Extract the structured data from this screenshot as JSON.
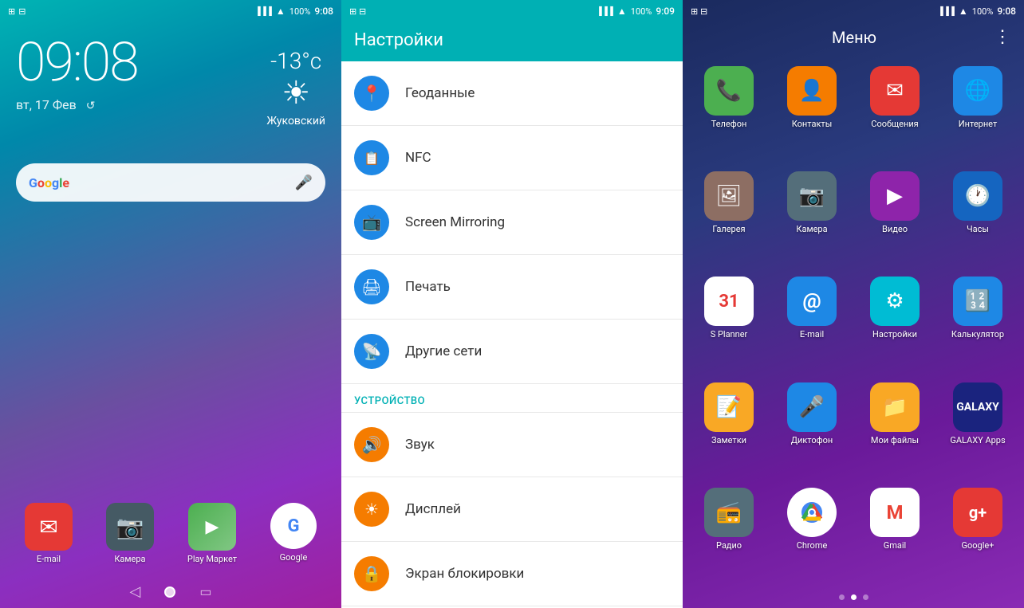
{
  "left": {
    "statusBar": {
      "screenshots": "⊞ ⊟",
      "signal": "▐▐▐▐",
      "wifi": "🛜",
      "battery": "100%",
      "time": "9:08"
    },
    "time": "09:08",
    "date": "вт, 17 Фев",
    "weather": {
      "temp": "-13°c",
      "city": "Жуковский",
      "icon": "☀"
    },
    "search": {
      "placeholder": "Google",
      "logo": "Google"
    },
    "dockApps": [
      {
        "id": "email",
        "label": "E-mail",
        "icon": "✉",
        "color": "#e53935"
      },
      {
        "id": "camera",
        "label": "Камера",
        "icon": "📷",
        "color": "#546e7a"
      },
      {
        "id": "play",
        "label": "Play\nМаркет",
        "icon": "▶",
        "color": "#4caf50"
      },
      {
        "id": "google",
        "label": "Google",
        "icon": "G",
        "color": "#fff"
      }
    ],
    "bottomNav": [
      "back",
      "home",
      "menu"
    ]
  },
  "middle": {
    "statusBar": {
      "signal": "▐▐▐▐",
      "wifi": "wifi",
      "battery": "100%",
      "time": "9:09"
    },
    "title": "Настройки",
    "items": [
      {
        "id": "geodata",
        "label": "Геоданные",
        "icon": "📍",
        "color": "#1e88e5"
      },
      {
        "id": "nfc",
        "label": "NFC",
        "icon": "📋",
        "color": "#1e88e5"
      },
      {
        "id": "screen-mirroring",
        "label": "Screen Mirroring",
        "icon": "📺",
        "color": "#1e88e5"
      },
      {
        "id": "print",
        "label": "Печать",
        "icon": "🖨",
        "color": "#1e88e5"
      },
      {
        "id": "other-networks",
        "label": "Другие сети",
        "icon": "📡",
        "color": "#1e88e5"
      }
    ],
    "sectionHeader": "УСТРОЙСТВО",
    "deviceItems": [
      {
        "id": "sound",
        "label": "Звук",
        "icon": "🔊",
        "color": "#f57c00"
      },
      {
        "id": "display",
        "label": "Дисплей",
        "icon": "☀",
        "color": "#f57c00"
      },
      {
        "id": "lock-screen",
        "label": "Экран блокировки",
        "icon": "🔒",
        "color": "#f57c00"
      }
    ]
  },
  "right": {
    "statusBar": {
      "signal": "▐▐▐▐",
      "wifi": "wifi",
      "battery": "100%",
      "time": "9:08"
    },
    "title": "Меню",
    "menuDots": "⋮",
    "apps": [
      {
        "id": "phone",
        "label": "Телефон",
        "icon": "📞",
        "color": "#4caf50"
      },
      {
        "id": "contacts",
        "label": "Контакты",
        "icon": "👤",
        "color": "#f57c00"
      },
      {
        "id": "messages",
        "label": "Сообщения",
        "icon": "✉",
        "color": "#e53935"
      },
      {
        "id": "internet",
        "label": "Интернет",
        "icon": "🌐",
        "color": "#1e88e5"
      },
      {
        "id": "gallery",
        "label": "Галерея",
        "icon": "🖼",
        "color": "#8d6e63"
      },
      {
        "id": "camera2",
        "label": "Камера",
        "icon": "📷",
        "color": "#546e7a"
      },
      {
        "id": "video",
        "label": "Видео",
        "icon": "▶",
        "color": "#8e24aa"
      },
      {
        "id": "clock",
        "label": "Часы",
        "icon": "🕐",
        "color": "#1e88e5"
      },
      {
        "id": "splanner",
        "label": "S Planner",
        "icon": "31",
        "color": "#ffffff"
      },
      {
        "id": "email2",
        "label": "E-mail",
        "icon": "@",
        "color": "#1e88e5"
      },
      {
        "id": "settings",
        "label": "Настройки",
        "icon": "⚙",
        "color": "#00bcd4"
      },
      {
        "id": "calculator",
        "label": "Калькулятор",
        "icon": "🔢",
        "color": "#1e88e5"
      },
      {
        "id": "notes",
        "label": "Заметки",
        "icon": "📝",
        "color": "#f9a825"
      },
      {
        "id": "recorder",
        "label": "Диктофон",
        "icon": "🎤",
        "color": "#1e88e5"
      },
      {
        "id": "myfiles",
        "label": "Мои файлы",
        "icon": "📁",
        "color": "#f9a825"
      },
      {
        "id": "galaxyapps",
        "label": "GALAXY Apps",
        "icon": "G",
        "color": "#1a237e"
      },
      {
        "id": "radio",
        "label": "Радио",
        "icon": "📻",
        "color": "#546e7a"
      },
      {
        "id": "chrome",
        "label": "Chrome",
        "icon": "◎",
        "color": "#ffffff"
      },
      {
        "id": "gmail",
        "label": "Gmail",
        "icon": "M",
        "color": "#ea4335"
      },
      {
        "id": "googleplus",
        "label": "Google+",
        "icon": "g+",
        "color": "#e53935"
      }
    ],
    "navDots": [
      false,
      true,
      false
    ]
  }
}
